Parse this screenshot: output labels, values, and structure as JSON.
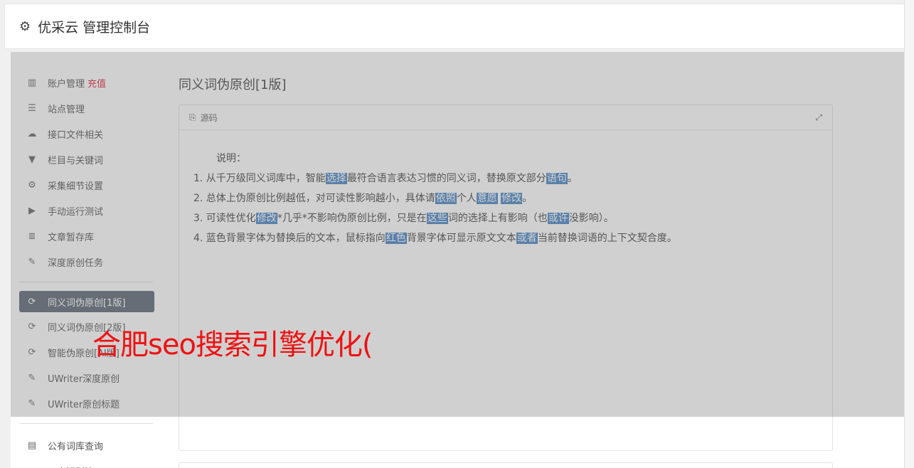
{
  "header": {
    "icon": "gear-icon",
    "title": "优采云 管理控制台"
  },
  "sidebar": {
    "group1": [
      {
        "icon": "bar-chart-icon",
        "label": "账户管理",
        "extra": "充值"
      },
      {
        "icon": "server-icon",
        "label": "站点管理"
      },
      {
        "icon": "cloud-upload-icon",
        "label": "接口文件相关"
      },
      {
        "icon": "filter-icon",
        "label": "栏目与关键词"
      },
      {
        "icon": "gears-icon",
        "label": "采集细节设置"
      },
      {
        "icon": "play-circle-icon",
        "label": "手动运行测试"
      },
      {
        "icon": "database-icon",
        "label": "文章暂存库"
      },
      {
        "icon": "edit-icon",
        "label": "深度原创任务"
      }
    ],
    "group2": [
      {
        "icon": "refresh-icon",
        "label": "同义词伪原创[1版]",
        "active": true
      },
      {
        "icon": "refresh-icon",
        "label": "同义词伪原创[2版]"
      },
      {
        "icon": "refresh-icon",
        "label": "智能伪原创[AI版]"
      },
      {
        "icon": "edit-icon",
        "label": "UWriter深度原创"
      },
      {
        "icon": "edit-icon",
        "label": "UWriter原创标题"
      }
    ],
    "group3": [
      {
        "icon": "book-icon",
        "label": "公有词库查询"
      },
      {
        "icon": "comment-icon",
        "label": "正文识别演示"
      }
    ]
  },
  "main": {
    "title": "同义词伪原创[1版]",
    "panel": {
      "head_label": "源码",
      "intro": "说明：",
      "lines": [
        [
          {
            "t": "1. 从千万级同义词库中，智能"
          },
          {
            "t": "选择",
            "hl": true
          },
          {
            "t": "最符合语言表达习惯的同义词，替换原文部分"
          },
          {
            "t": "语句",
            "hl": true
          },
          {
            "t": "。"
          }
        ],
        [
          {
            "t": "2. 总体上伪原创比例越低，对可读性影响越小，具体请"
          },
          {
            "t": "依照",
            "hl": true
          },
          {
            "t": "个人"
          },
          {
            "t": "意愿",
            "hl": true
          },
          {
            "t": " "
          },
          {
            "t": "修改",
            "hl": true
          },
          {
            "t": "。"
          }
        ],
        [
          {
            "t": "3. 可读性优化"
          },
          {
            "t": "修改",
            "hl": true
          },
          {
            "t": "*几乎*不影响伪原创比例，只是在"
          },
          {
            "t": "这些",
            "hl": true
          },
          {
            "t": "词的选择上有影响（也"
          },
          {
            "t": "或许",
            "hl": true
          },
          {
            "t": "没影响）。"
          }
        ],
        [
          {
            "t": "4. 蓝色背景字体为替换后的文本，鼠标指向"
          },
          {
            "t": "红色",
            "hl": true
          },
          {
            "t": "背景字体可显示原文文本"
          },
          {
            "t": "或者",
            "hl": true
          },
          {
            "t": "当前替换词语的上下文契合度。"
          }
        ]
      ]
    }
  },
  "watermark": "合肥seo搜索引擎优化("
}
